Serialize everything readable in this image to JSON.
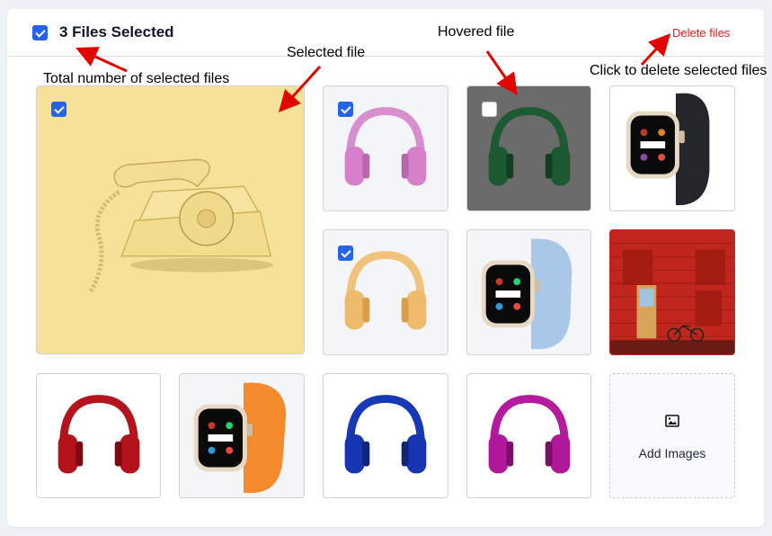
{
  "header": {
    "selection_title": "3 Files Selected",
    "select_all_checked": true,
    "delete_label": "Delete files"
  },
  "annotations": {
    "total": "Total number of selected files",
    "selected": "Selected file",
    "hovered": "Hovered file",
    "delete": "Click to delete selected files"
  },
  "files": [
    {
      "name": "rotary-phone",
      "selected": true
    },
    {
      "name": "pink-headphones",
      "selected": true
    },
    {
      "name": "green-headphones",
      "selected": false,
      "hovered": true
    },
    {
      "name": "apple-watch-black",
      "selected": false
    },
    {
      "name": "orange-headphones",
      "selected": true
    },
    {
      "name": "apple-watch-blue",
      "selected": false
    },
    {
      "name": "red-brick-building",
      "selected": false
    },
    {
      "name": "red-headphones",
      "selected": false
    },
    {
      "name": "apple-watch-orange",
      "selected": false
    },
    {
      "name": "blue-headphones",
      "selected": false
    },
    {
      "name": "magenta-headphones",
      "selected": false
    }
  ],
  "add_tile": {
    "label": "Add Images",
    "icon": "image-icon"
  },
  "colors": {
    "accent": "#2563eb",
    "danger": "#e11d1d",
    "annotation_arrow": "#e10600"
  }
}
